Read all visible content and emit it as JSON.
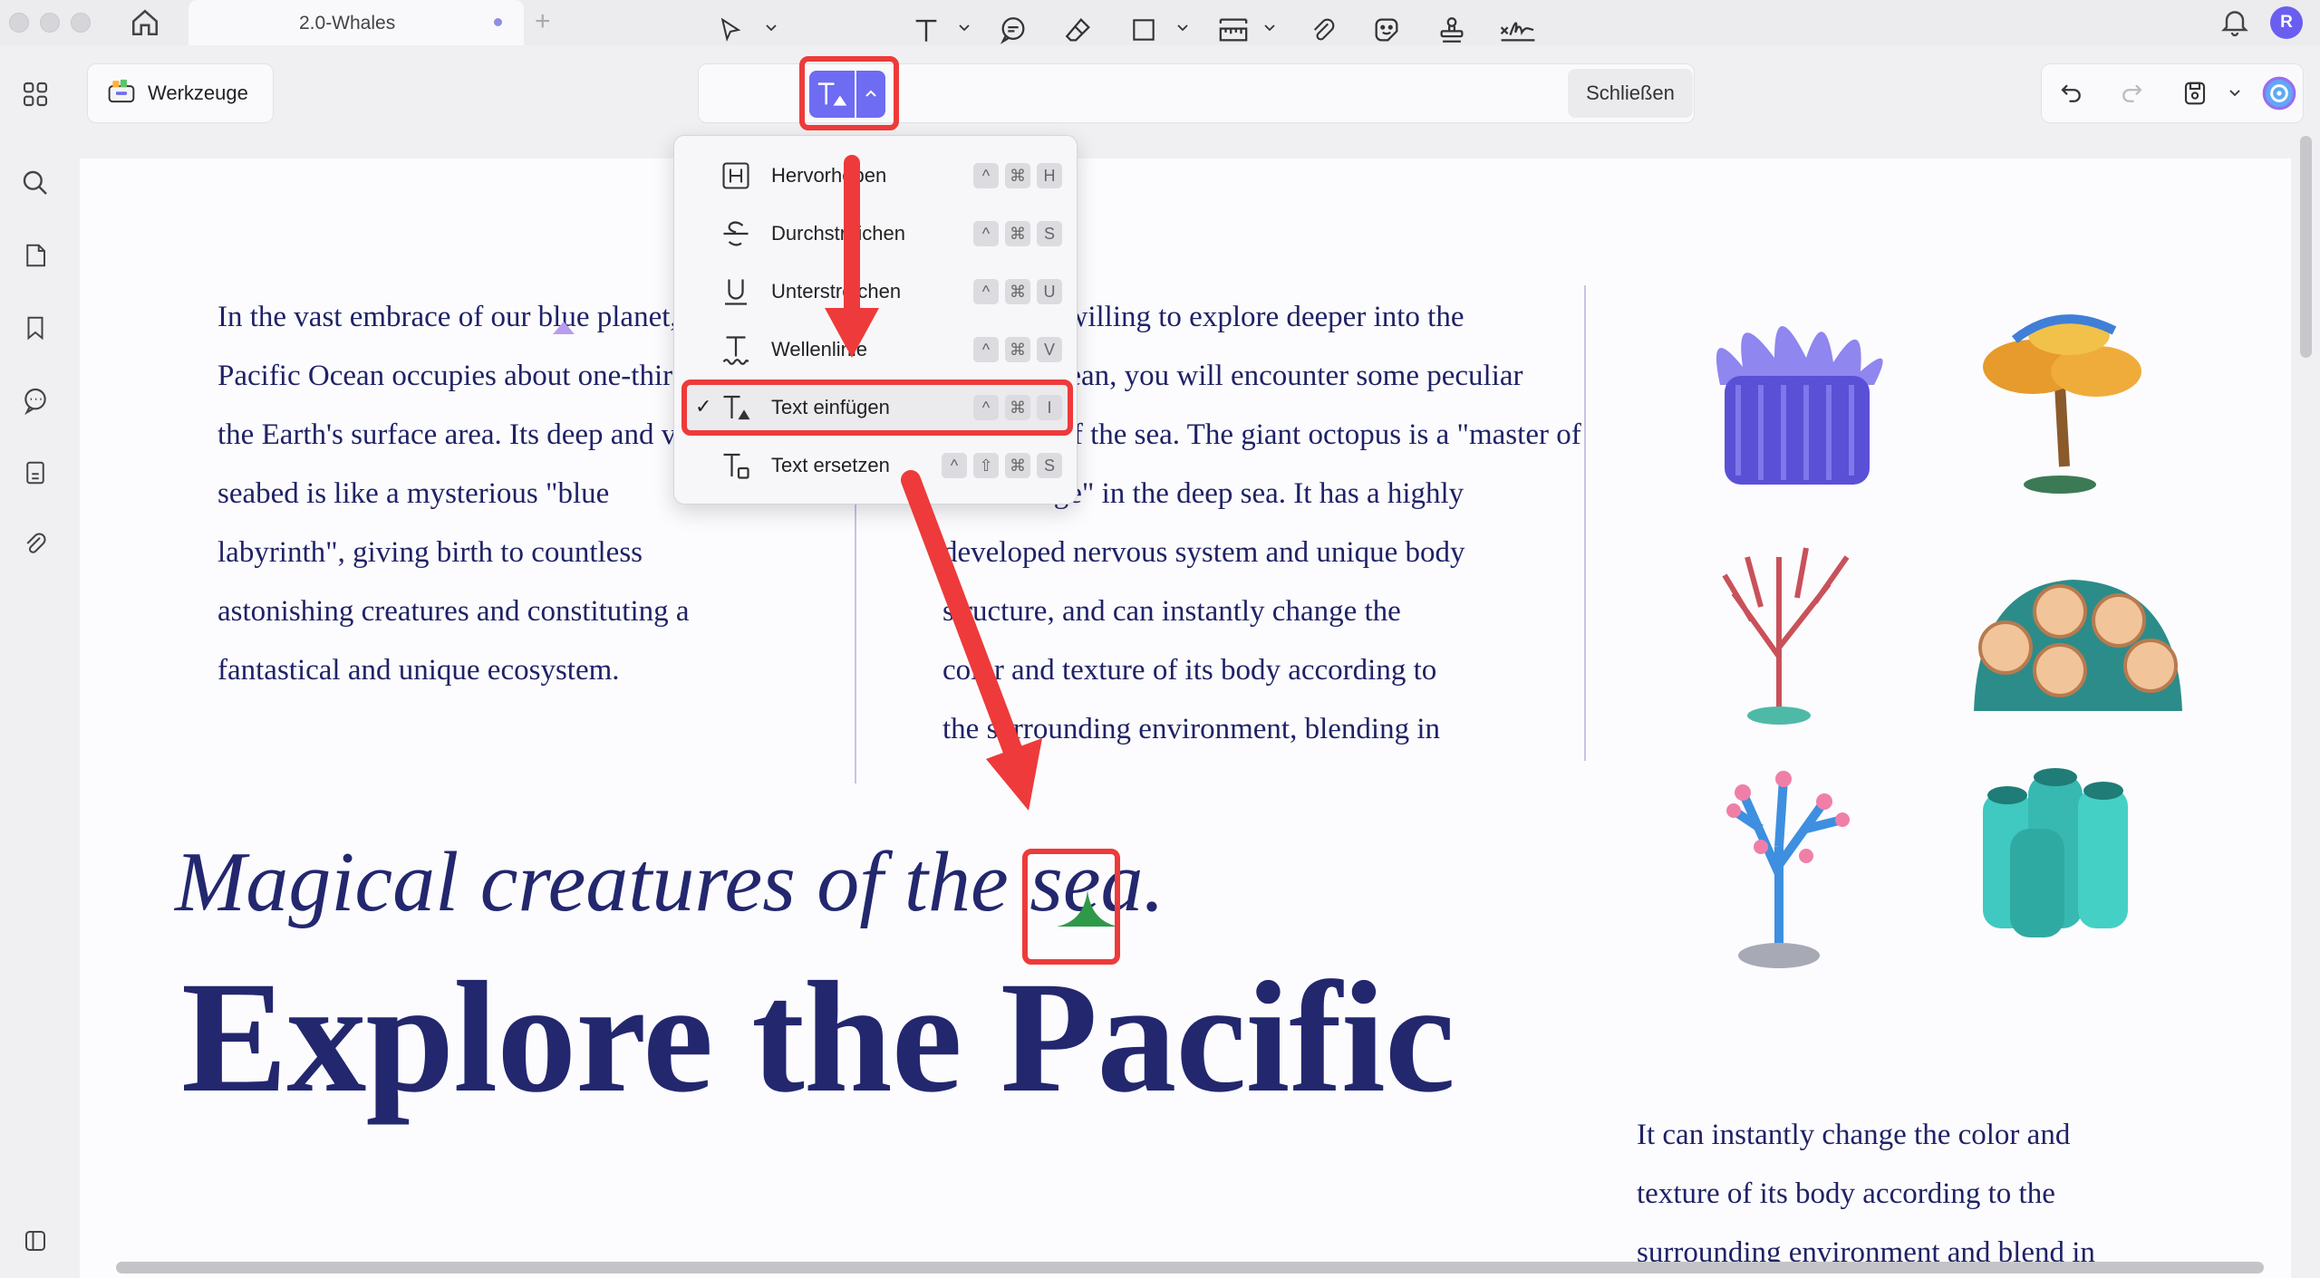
{
  "window": {
    "tab_title": "2.0-Whales",
    "new_tab_symbol": "+",
    "avatar_initial": "R"
  },
  "toolbar": {
    "tools_label": "Werkzeuge",
    "close_label": "Schließen"
  },
  "menu": {
    "items": [
      {
        "label": "Hervorheben",
        "keys": [
          "^",
          "⌘",
          "H"
        ],
        "checked": false
      },
      {
        "label": "Durchstreichen",
        "keys": [
          "^",
          "⌘",
          "S"
        ],
        "checked": false
      },
      {
        "label": "Unterstreichen",
        "keys": [
          "^",
          "⌘",
          "U"
        ],
        "checked": false
      },
      {
        "label": "Wellenlinie",
        "keys": [
          "^",
          "⌘",
          "V"
        ],
        "checked": false
      },
      {
        "label": "Text einfügen",
        "keys": [
          "^",
          "⌘",
          "I"
        ],
        "checked": true,
        "check_mark": "✓"
      },
      {
        "label": "Text ersetzen",
        "keys": [
          "^",
          "⇧",
          "⌘",
          "S"
        ],
        "checked": false
      }
    ]
  },
  "document": {
    "col1": [
      "In the vast embrace of our blue planet, the",
      "Pacific Ocean occupies about one-third of",
      "the Earth's surface area. Its deep and vast",
      "seabed is like a mysterious \"blue",
      "labyrinth\", giving birth to countless",
      "astonishing creatures and constituting a",
      "fantastical and unique ecosystem."
    ],
    "col2": [
      "If you are willing to explore deeper into the",
      "Pacific Ocean, you will encounter some peculiar",
      "creatures of the sea. The giant octopus is a \"master of",
      "camouflage\" in the deep sea. It has a highly",
      "developed nervous system and unique body",
      "structure, and can instantly change the",
      "color and texture of its body according to",
      "the surrounding environment, blending in"
    ],
    "subtitle": "Magical creatures of the sea.",
    "headline": "Explore the Pacific",
    "col3": [
      "It can instantly change the color and",
      "texture of its body according to the",
      "surrounding environment and blend in"
    ]
  },
  "colors": {
    "accent": "#6e6cf2",
    "annotation_red": "#ee3a3a",
    "doc_text": "#1f2266",
    "caret_marker": "#2e9a48"
  }
}
